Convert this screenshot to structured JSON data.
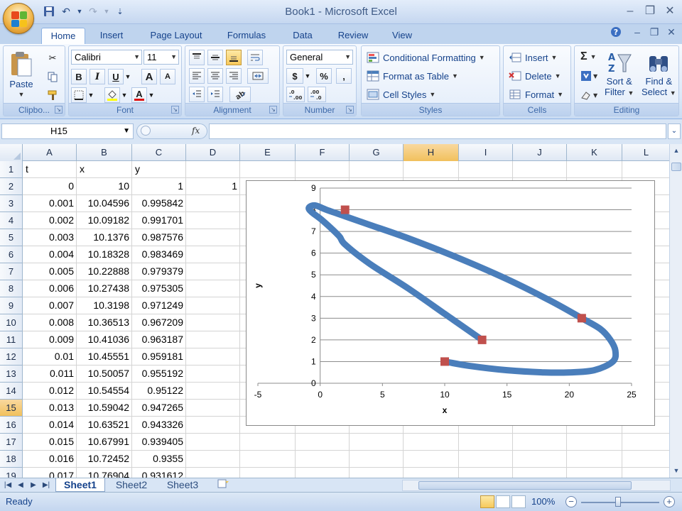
{
  "window": {
    "title": "Book1 - Microsoft Excel"
  },
  "tabs": [
    "Home",
    "Insert",
    "Page Layout",
    "Formulas",
    "Data",
    "Review",
    "View"
  ],
  "active_tab": "Home",
  "ribbon": {
    "clipboard": {
      "label": "Clipbo...",
      "paste": "Paste"
    },
    "font": {
      "label": "Font",
      "font_name": "Calibri",
      "font_size": "11",
      "bold": "B",
      "italic": "I",
      "underline": "U",
      "grow": "A",
      "shrink": "A",
      "font_color_letter": "A"
    },
    "alignment": {
      "label": "Alignment"
    },
    "number": {
      "label": "Number",
      "format": "General",
      "currency": "$",
      "percent": "%",
      "comma": ","
    },
    "styles": {
      "label": "Styles",
      "conditional": "Conditional Formatting",
      "format_table": "Format as Table",
      "cell_styles": "Cell Styles"
    },
    "cells": {
      "label": "Cells",
      "insert": "Insert",
      "delete": "Delete",
      "format": "Format"
    },
    "editing": {
      "label": "Editing",
      "sum": "Σ",
      "sort1": "Sort &",
      "sort2": "Filter",
      "find1": "Find &",
      "find2": "Select"
    }
  },
  "formula_bar": {
    "name_box": "H15",
    "fx": "fx",
    "formula": ""
  },
  "columns": [
    "A",
    "B",
    "C",
    "D",
    "E",
    "F",
    "G",
    "H",
    "I",
    "J",
    "K",
    "L"
  ],
  "selected_column": "H",
  "rows": [
    {
      "n": "1",
      "A": "t",
      "B": "x",
      "C": "y",
      "D": ""
    },
    {
      "n": "2",
      "A": "0",
      "B": "10",
      "C": "1",
      "D": "1"
    },
    {
      "n": "3",
      "A": "0.001",
      "B": "10.04596",
      "C": "0.995842",
      "D": ""
    },
    {
      "n": "4",
      "A": "0.002",
      "B": "10.09182",
      "C": "0.991701",
      "D": ""
    },
    {
      "n": "5",
      "A": "0.003",
      "B": "10.1376",
      "C": "0.987576",
      "D": ""
    },
    {
      "n": "6",
      "A": "0.004",
      "B": "10.18328",
      "C": "0.983469",
      "D": ""
    },
    {
      "n": "7",
      "A": "0.005",
      "B": "10.22888",
      "C": "0.979379",
      "D": ""
    },
    {
      "n": "8",
      "A": "0.006",
      "B": "10.27438",
      "C": "0.975305",
      "D": ""
    },
    {
      "n": "9",
      "A": "0.007",
      "B": "10.3198",
      "C": "0.971249",
      "D": ""
    },
    {
      "n": "10",
      "A": "0.008",
      "B": "10.36513",
      "C": "0.967209",
      "D": ""
    },
    {
      "n": "11",
      "A": "0.009",
      "B": "10.41036",
      "C": "0.963187",
      "D": ""
    },
    {
      "n": "12",
      "A": "0.01",
      "B": "10.45551",
      "C": "0.959181",
      "D": ""
    },
    {
      "n": "13",
      "A": "0.011",
      "B": "10.50057",
      "C": "0.955192",
      "D": ""
    },
    {
      "n": "14",
      "A": "0.012",
      "B": "10.54554",
      "C": "0.95122",
      "D": ""
    },
    {
      "n": "15",
      "A": "0.013",
      "B": "10.59042",
      "C": "0.947265",
      "D": ""
    },
    {
      "n": "16",
      "A": "0.014",
      "B": "10.63521",
      "C": "0.943326",
      "D": ""
    },
    {
      "n": "17",
      "A": "0.015",
      "B": "10.67991",
      "C": "0.939405",
      "D": ""
    },
    {
      "n": "18",
      "A": "0.016",
      "B": "10.72452",
      "C": "0.9355",
      "D": ""
    },
    {
      "n": "19",
      "A": "0.017",
      "B": "10.76904",
      "C": "0.931612",
      "D": ""
    }
  ],
  "selected_row": "15",
  "chart_data": {
    "type": "scatter",
    "title": "",
    "xlabel": "x",
    "ylabel": "y",
    "xlim": [
      -5,
      25
    ],
    "ylim": [
      0,
      9
    ],
    "xticks": [
      -5,
      0,
      5,
      10,
      15,
      20,
      25
    ],
    "yticks": [
      0,
      1,
      2,
      3,
      4,
      5,
      6,
      7,
      8,
      9
    ],
    "grid": "horizontal",
    "legend": "none",
    "series": [
      {
        "line_color": "#4a7ebb",
        "x": [
          10,
          12,
          15,
          18,
          20,
          22,
          23.5,
          23.7,
          23.3,
          22.5,
          21,
          18.5,
          15,
          11,
          7,
          4,
          2,
          0.5,
          -0.4,
          -0.9,
          -0.7,
          0.2,
          1.5,
          2,
          4,
          7,
          10,
          12,
          13
        ],
        "y": [
          1,
          0.8,
          0.6,
          0.5,
          0.5,
          0.6,
          1,
          1.5,
          2,
          2.5,
          3,
          3.8,
          4.8,
          5.8,
          6.7,
          7.3,
          7.7,
          8,
          8.2,
          8.1,
          7.9,
          7.5,
          6.8,
          6.4,
          5.5,
          4.4,
          3.2,
          2.4,
          2
        ]
      }
    ],
    "markers": {
      "color": "#c0504d",
      "x": [
        10,
        21,
        2,
        13
      ],
      "y": [
        1,
        3,
        8,
        2
      ]
    }
  },
  "sheets": [
    "Sheet1",
    "Sheet2",
    "Sheet3"
  ],
  "active_sheet": "Sheet1",
  "status": {
    "text": "Ready",
    "zoom": "100%",
    "zoom_minus": "−",
    "zoom_plus": "+"
  }
}
